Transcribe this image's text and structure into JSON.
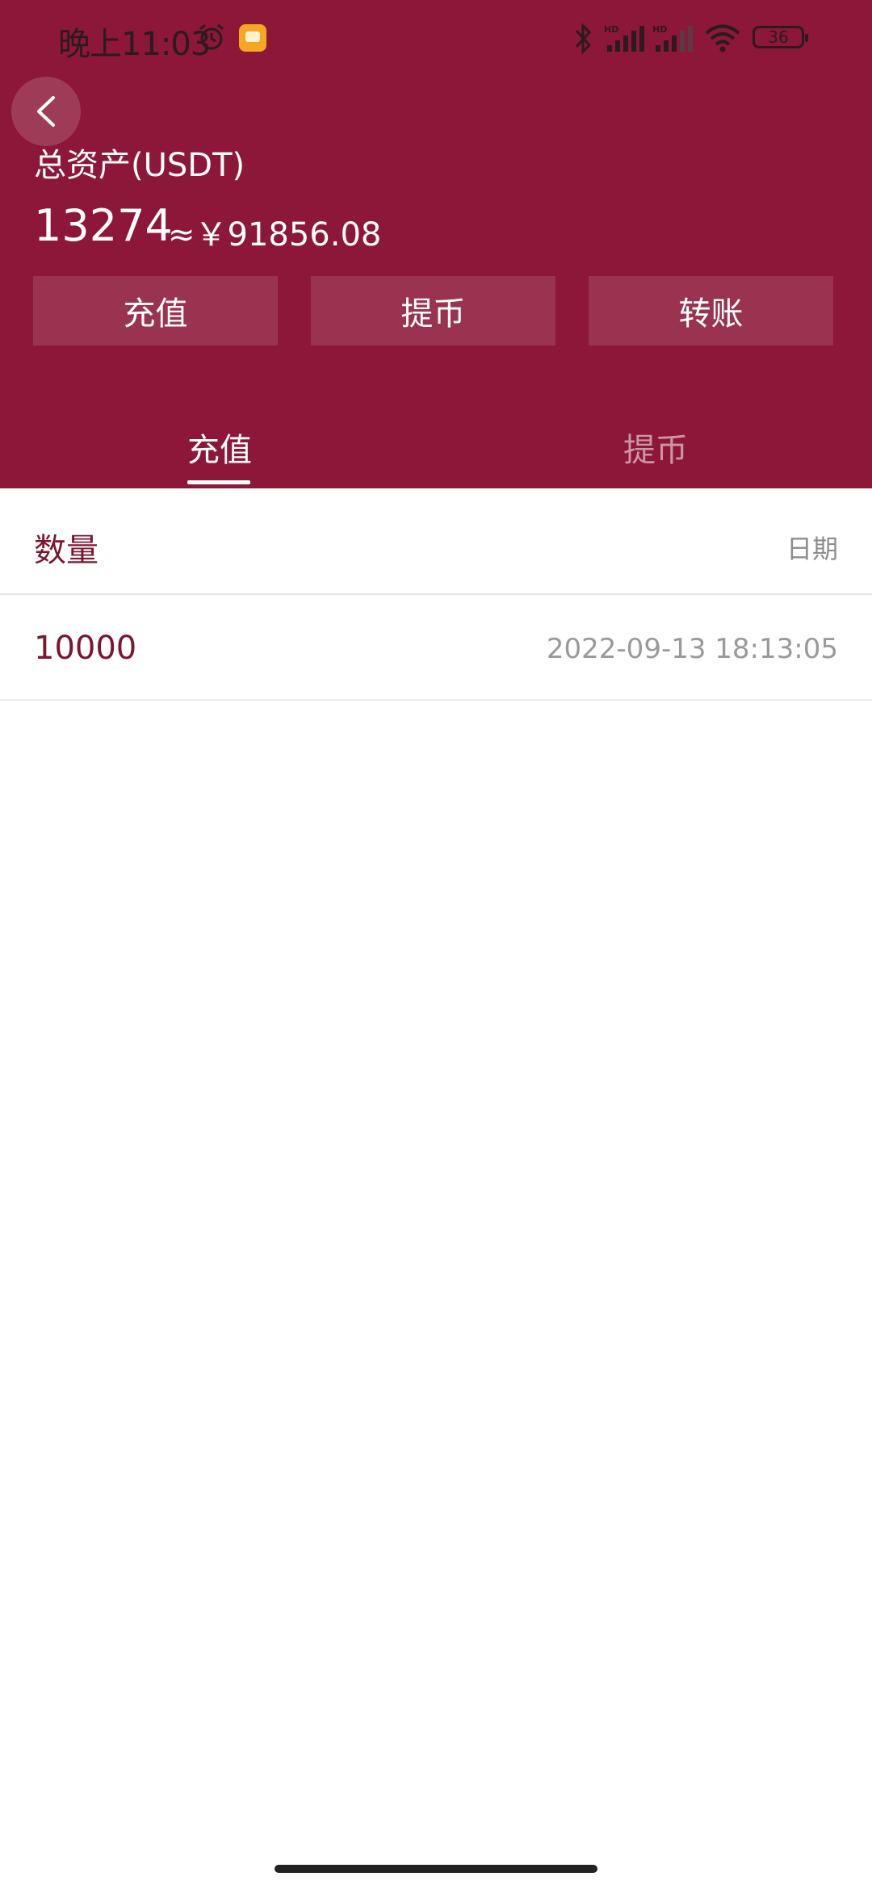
{
  "status_bar": {
    "time": "晚上11:03",
    "battery": "36",
    "signal_1_label": "HD",
    "signal_2_label": "HD"
  },
  "assets": {
    "label": "总资产(USDT)",
    "amount": "13274",
    "cny_equivalent": "≈￥91856.08"
  },
  "actions": {
    "deposit": "充值",
    "withdraw": "提币",
    "transfer": "转账"
  },
  "tabs": [
    {
      "label": "充值",
      "active": true
    },
    {
      "label": "提币",
      "active": false
    }
  ],
  "list": {
    "columns": {
      "quantity": "数量",
      "date": "日期"
    },
    "rows": [
      {
        "quantity": "10000",
        "date": "2022-09-13 18:13:05"
      }
    ]
  },
  "colors": {
    "header_bg": "#8c1738",
    "accent_text": "#7a1730"
  }
}
